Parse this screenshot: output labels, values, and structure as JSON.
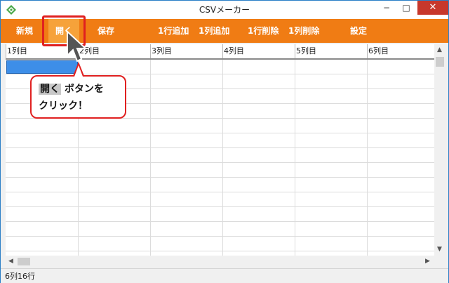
{
  "window": {
    "title": "CSVメーカー",
    "icon": "diamond-app-icon",
    "minimize_glyph": "−",
    "maximize_glyph": "□",
    "close_glyph": "✕"
  },
  "toolbar": {
    "buttons": [
      {
        "label": "新規"
      },
      {
        "label": "開く"
      },
      {
        "label": "保存"
      },
      {
        "label": "1行追加"
      },
      {
        "label": "1列追加"
      },
      {
        "label": "1行削除"
      },
      {
        "label": "1列削除"
      },
      {
        "label": "設定"
      }
    ],
    "accent_color": "#f07c14"
  },
  "grid": {
    "columns": [
      "1列目",
      "2列目",
      "3列目",
      "4列目",
      "5列目",
      "6列目"
    ],
    "row_count": 16
  },
  "status": {
    "text": "6列16行"
  },
  "callout": {
    "key_label": "開く",
    "line1_rest": " ボタンを",
    "line2": "クリック！"
  }
}
